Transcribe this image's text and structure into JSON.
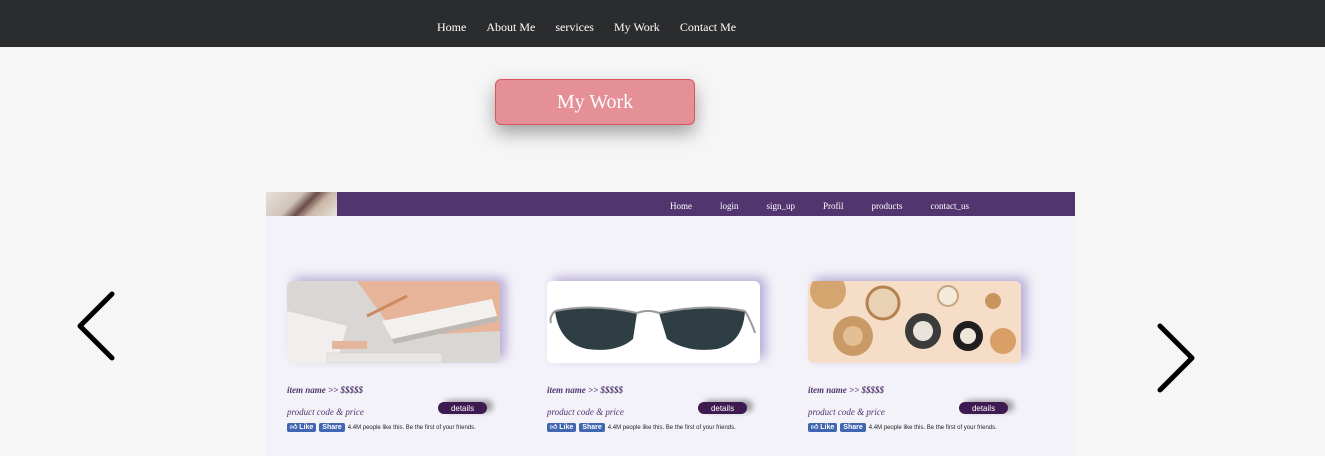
{
  "top_nav": {
    "links": [
      "Home",
      "About Me",
      "services",
      "My Work",
      "Contact Me"
    ]
  },
  "section_title": "My Work",
  "carousel": {
    "prev_icon": "chevron-left-icon",
    "next_icon": "chevron-right-icon"
  },
  "preview": {
    "nav_color": "#52356f",
    "nav_links": [
      "Home",
      "login",
      "sign_up",
      "Profil",
      "products",
      "contact_us"
    ],
    "cards": [
      {
        "item_name": "item name >> $$$$$",
        "code_price": "product code & price",
        "details_label": "details",
        "like_label": "Like",
        "share_label": "Share",
        "like_text": "4.4M people like this. Be the first of your friends."
      },
      {
        "item_name": "item name >> $$$$$",
        "code_price": "product code & price",
        "details_label": "details",
        "like_label": "Like",
        "share_label": "Share",
        "like_text": "4.4M people like this. Be the first of your friends."
      },
      {
        "item_name": "item name >> $$$$$",
        "code_price": "product code & price",
        "details_label": "details",
        "like_label": "Like",
        "share_label": "Share",
        "like_text": "4.4M people like this. Be the first of your friends."
      }
    ]
  }
}
